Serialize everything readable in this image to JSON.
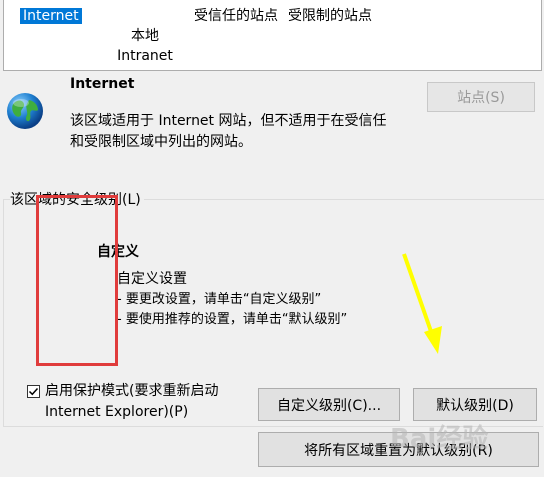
{
  "zones": {
    "items": [
      {
        "label": "Internet",
        "selected": true
      },
      {
        "label": "本地\nIntranet",
        "selected": false
      },
      {
        "label": "受信任的站点",
        "selected": false
      },
      {
        "label": "受限制的站点",
        "selected": false
      }
    ]
  },
  "zone_info": {
    "icon": "globe-icon",
    "title": "Internet",
    "description": "该区域适用于 Internet 网站，但不适用于在受信任和受限制区域中列出的网站。",
    "sites_button": "站点(S)"
  },
  "security_level": {
    "group_label": "该区域的安全级别(L)",
    "level_name": "自定义",
    "summary": "自定义设置",
    "bullets": [
      "- 要更改设置，请单击“自定义级别”",
      "- 要使用推荐的设置，请单击“默认级别”"
    ],
    "protected_mode_label": "启用保护模式(要求重新启动\nInternet Explorer)(P)",
    "protected_mode_checked": true,
    "custom_level_button": "自定义级别(C)...",
    "default_level_button": "默认级别(D)"
  },
  "reset_all_button": "将所有区域重置为默认级别(R)",
  "watermark": "Bai经验",
  "colors": {
    "selection": "#0078d7",
    "annotation_box": "#e03c3c",
    "annotation_arrow": "#ffff00"
  }
}
